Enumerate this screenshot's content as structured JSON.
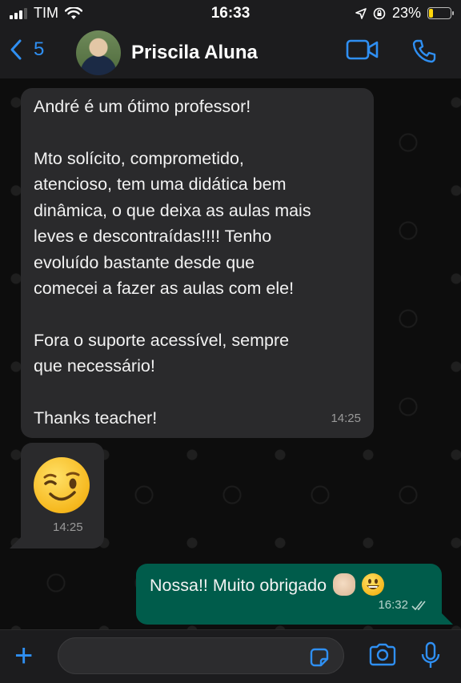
{
  "status_bar": {
    "carrier": "TIM",
    "time": "16:33",
    "battery": "23%"
  },
  "header": {
    "back_count": "5",
    "contact_name": "Priscila Aluna"
  },
  "messages": [
    {
      "direction": "incoming",
      "paragraphs": [
        [
          "André é um ótimo professor!"
        ],
        [
          "Mto solícito, comprometido,",
          "atencioso, tem uma didática bem",
          "dinâmica, o que deixa as  aulas mais",
          "leves e descontraídas!!!! Tenho",
          "evoluído bastante desde que",
          "comecei a fazer as aulas com ele!"
        ],
        [
          "Fora o suporte acessível, sempre",
          "que necessário!"
        ],
        [
          "Thanks teacher!"
        ]
      ],
      "time": "14:25"
    },
    {
      "direction": "incoming",
      "emoji": "winking-face",
      "time": "14:25"
    },
    {
      "direction": "outgoing",
      "text": "Nossa!! Muito obrigado",
      "emojis": [
        "clapping-hands",
        "grinning-face"
      ],
      "time": "16:32",
      "status": "read"
    }
  ],
  "colors": {
    "accent": "#2f8ff2",
    "incoming_bubble": "#2a2a2c",
    "outgoing_bubble": "#005c4b",
    "battery_low": "#ffd60a"
  }
}
